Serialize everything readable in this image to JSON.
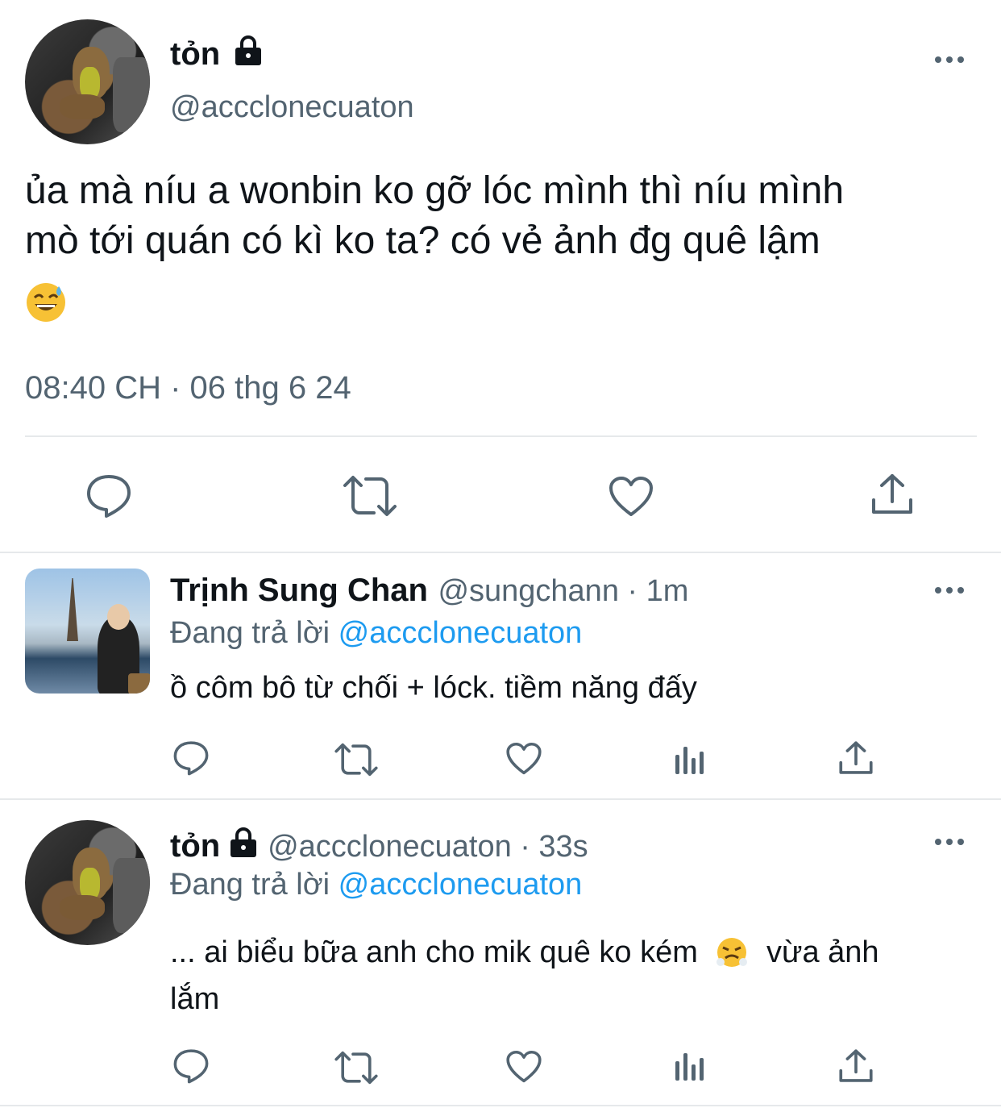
{
  "main_tweet": {
    "name": "tỏn",
    "handle": "@accclonecuaton",
    "text_line1": "ủa mà níu a wonbin ko gỡ lóc mình thì níu mình",
    "text_line2": "mò tới quán có kì ko ta? có vẻ ảnh đg quê lậm",
    "emoji": "😅",
    "timestamp": "08:40 CH · 06 thg 6 24"
  },
  "reply1": {
    "name": "Trịnh Sung Chan",
    "handle": "@sungchann",
    "time": "· 1m",
    "replying_prefix": "Đang trả lời",
    "replying_to": "@accclonecuaton",
    "text": "ồ côm bô từ chối + lóck. tiềm năng đấy"
  },
  "reply2": {
    "name": "tỏn",
    "handle": "@accclonecuaton",
    "time": "· 33s",
    "replying_prefix": "Đang trả lời",
    "replying_to": "@accclonecuaton",
    "text_line1": "... ai biểu bữa anh cho mik quê ko kém",
    "emoji": "😤",
    "text_line1b": "vừa ảnh",
    "text_line2": "lắm"
  },
  "more_label": "•••",
  "icons": [
    "lock-icon",
    "reply-icon",
    "retweet-icon",
    "like-icon",
    "share-icon",
    "views-icon",
    "more-icon"
  ],
  "colors": {
    "link": "#1d9bf0",
    "secondary": "#536471",
    "icon": "#536471"
  }
}
